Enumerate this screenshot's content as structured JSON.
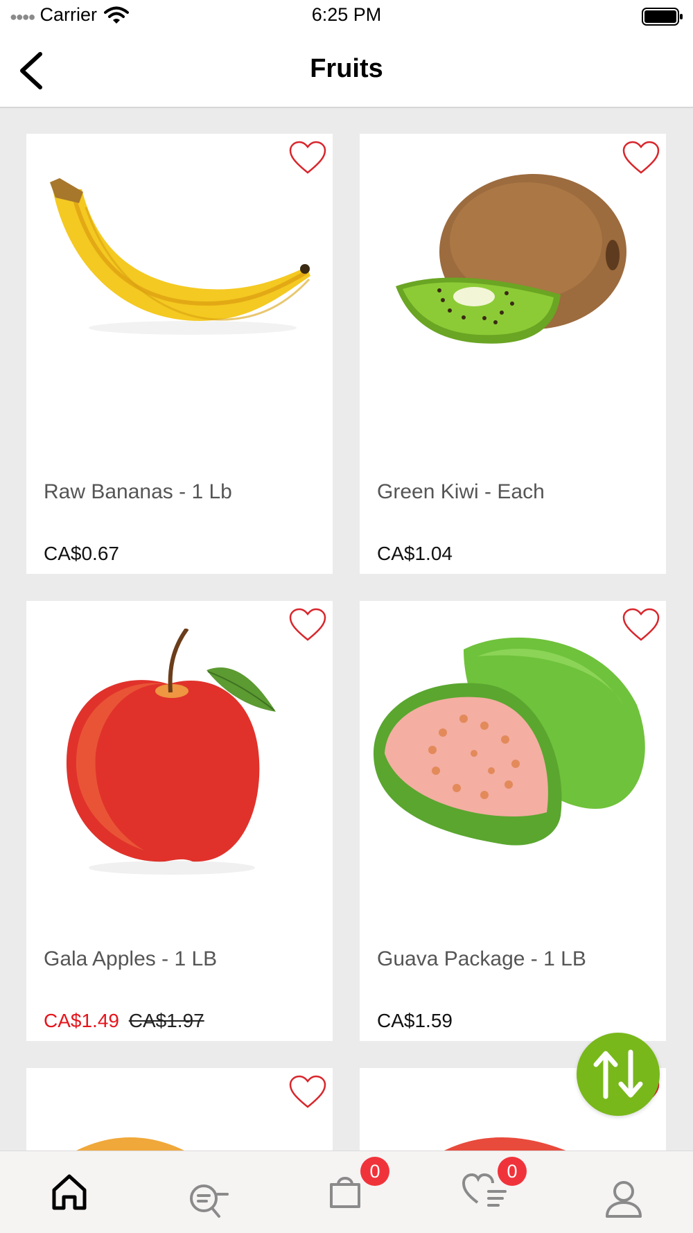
{
  "status_bar": {
    "carrier": "Carrier",
    "time": "6:25 PM"
  },
  "nav": {
    "title": "Fruits",
    "back_icon": "chevron-left-icon"
  },
  "products": [
    {
      "name": "Raw Bananas - 1 Lb",
      "price": "CA$0.67",
      "image": "banana"
    },
    {
      "name": "Green Kiwi - Each",
      "price": "CA$1.04",
      "image": "kiwi"
    },
    {
      "name": "Gala Apples - 1 LB",
      "sale_price": "CA$1.49",
      "old_price": "CA$1.97",
      "image": "apple"
    },
    {
      "name": "Guava Package - 1 LB",
      "price": "CA$1.59",
      "image": "guava"
    }
  ],
  "colors": {
    "sale": "#e5151b",
    "fab": "#78b81a",
    "badge": "#f0333b",
    "heart": "#d8262c"
  },
  "tab_bar": {
    "tabs": [
      {
        "name": "home",
        "icon": "home-icon",
        "active": true
      },
      {
        "name": "search",
        "icon": "search-list-icon"
      },
      {
        "name": "cart",
        "icon": "shopping-bag-icon",
        "badge": "0"
      },
      {
        "name": "wishlist",
        "icon": "heart-list-icon",
        "badge": "0"
      },
      {
        "name": "profile",
        "icon": "user-icon"
      }
    ]
  }
}
